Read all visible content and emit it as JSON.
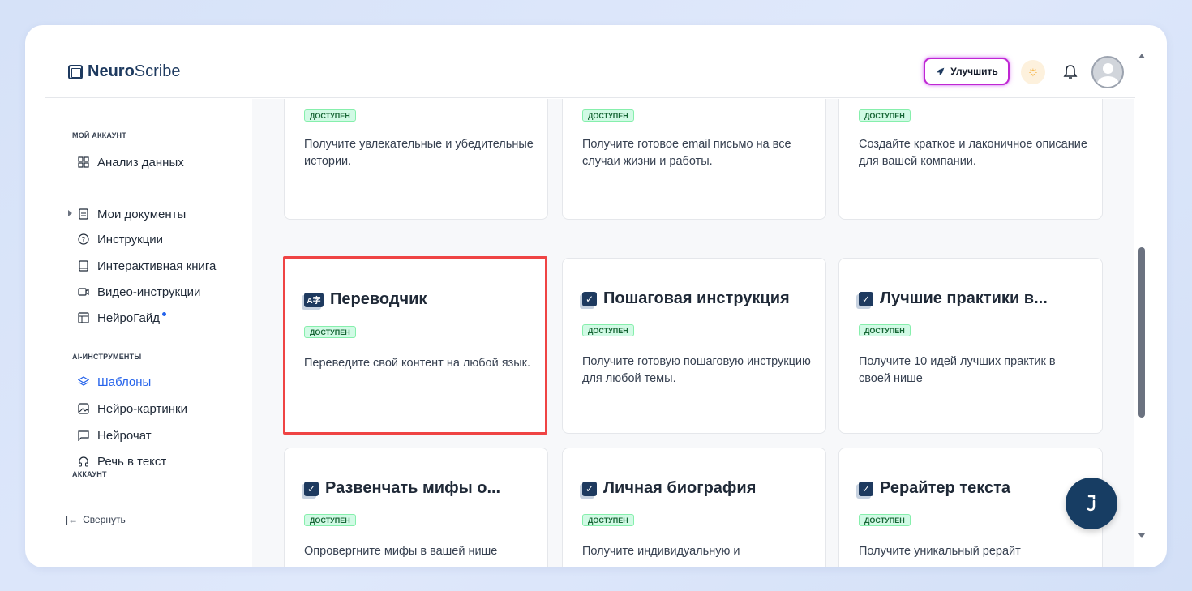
{
  "app": {
    "logo_bold": "Neuro",
    "logo_rest": "Scribe"
  },
  "header": {
    "upgrade_label": "Улучшить"
  },
  "sidebar": {
    "section_account": "МОЙ АККАУНТ",
    "items_account": [
      {
        "label": "Анализ данных",
        "icon": "grid-icon"
      },
      {
        "label": "Мои документы",
        "icon": "document-icon"
      },
      {
        "label": "Инструкции",
        "icon": "help-circle-icon"
      },
      {
        "label": "Интерактивная книга",
        "icon": "book-icon"
      },
      {
        "label": "Видео-инструкции",
        "icon": "video-icon"
      },
      {
        "label": "НейроГайд",
        "icon": "table-icon"
      }
    ],
    "section_ai": "AI-ИНСТРУМЕНТЫ",
    "items_ai": [
      {
        "label": "Шаблоны",
        "icon": "layers-icon",
        "active": true
      },
      {
        "label": "Нейро-картинки",
        "icon": "image-icon"
      },
      {
        "label": "Нейрочат",
        "icon": "chat-icon"
      },
      {
        "label": "Речь в текст",
        "icon": "headphones-icon"
      }
    ],
    "section_account2": "АККАУНТ",
    "collapse_label": "Свернуть"
  },
  "cards": [
    {
      "title": "",
      "badge": "ДОСТУПЕН",
      "desc": "Получите увлекательные и убедительные истории."
    },
    {
      "title": "",
      "badge": "ДОСТУПЕН",
      "desc": "Получите готовое email письмо на все случаи жизни и работы."
    },
    {
      "title": "",
      "badge": "ДОСТУПЕН",
      "desc": "Создайте краткое и лаконичное описание для вашей компании."
    },
    {
      "title": "Переводчик",
      "badge": "ДОСТУПЕН",
      "desc": "Переведите свой контент на любой язык.",
      "icon": "translate-icon"
    },
    {
      "title": "Пошаговая инструкция",
      "badge": "ДОСТУПЕН",
      "desc": "Получите готовую пошаговую инструкцию для любой темы.",
      "icon": "checkbox-icon"
    },
    {
      "title": "Лучшие практики в...",
      "badge": "ДОСТУПЕН",
      "desc": "Получите 10 идей лучших практик в своей нише",
      "icon": "checkbox-icon"
    },
    {
      "title": "Развенчать мифы о...",
      "badge": "ДОСТУПЕН",
      "desc": "Опровергните мифы в вашей нише",
      "icon": "checkbox-icon"
    },
    {
      "title": "Личная биография",
      "badge": "ДОСТУПЕН",
      "desc": "Получите индивидуальную и",
      "icon": "checkbox-icon"
    },
    {
      "title": "Рерайтер текста",
      "badge": "ДОСТУПЕН",
      "desc": "Получите уникальный рерайт",
      "icon": "checkbox-icon"
    }
  ],
  "colors": {
    "accent": "#2563eb",
    "brand_dark": "#1e3a5f",
    "highlight_border": "#ef4444",
    "badge_bg": "#d1fae5"
  }
}
